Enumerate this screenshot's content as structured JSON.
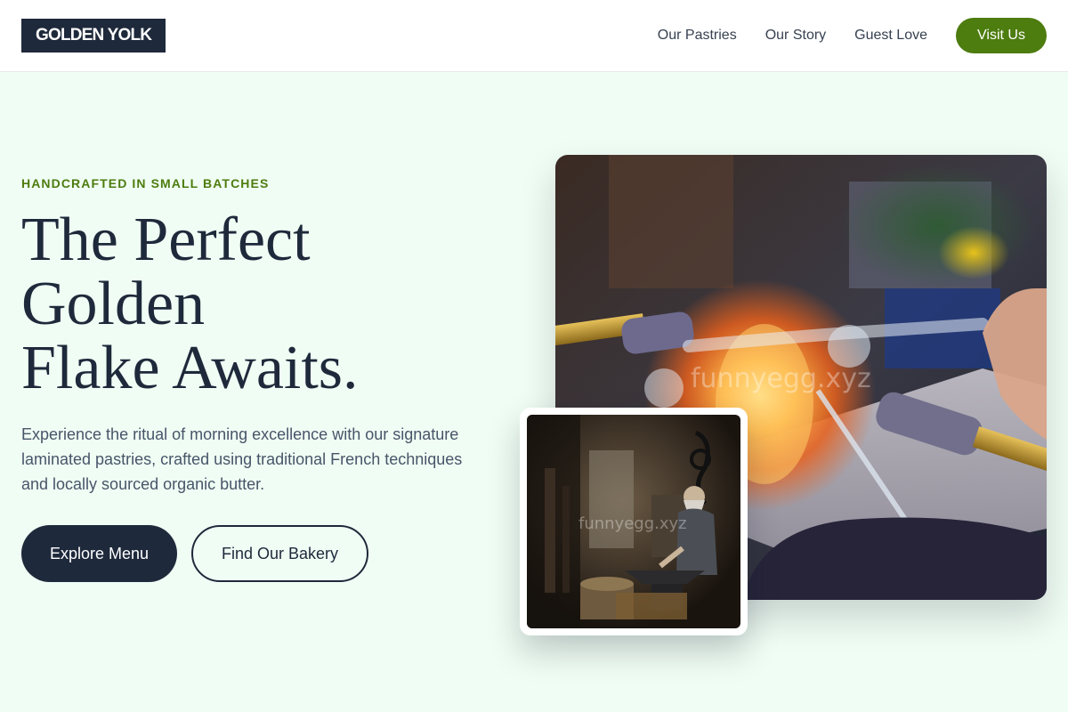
{
  "header": {
    "logo": "GOLDEN YOLK",
    "nav": [
      {
        "label": "Our Pastries"
      },
      {
        "label": "Our Story"
      },
      {
        "label": "Guest Love"
      }
    ],
    "cta": "Visit Us"
  },
  "hero": {
    "eyebrow": "HANDCRAFTED IN SMALL BATCHES",
    "headline_lines": [
      "The Perfect",
      "Golden",
      "Flake Awaits."
    ],
    "description": "Experience the ritual of morning excellence with our signature laminated pastries, crafted using traditional French techniques and locally sourced organic butter.",
    "primary_button": "Explore Menu",
    "secondary_button": "Find Our Bakery"
  },
  "images": {
    "main_watermark": "funnyegg.xyz",
    "inset_watermark": "funnyegg.xyz"
  },
  "colors": {
    "accent": "#4d7c0f",
    "dark": "#1e293b",
    "background": "#f0fdf4"
  }
}
